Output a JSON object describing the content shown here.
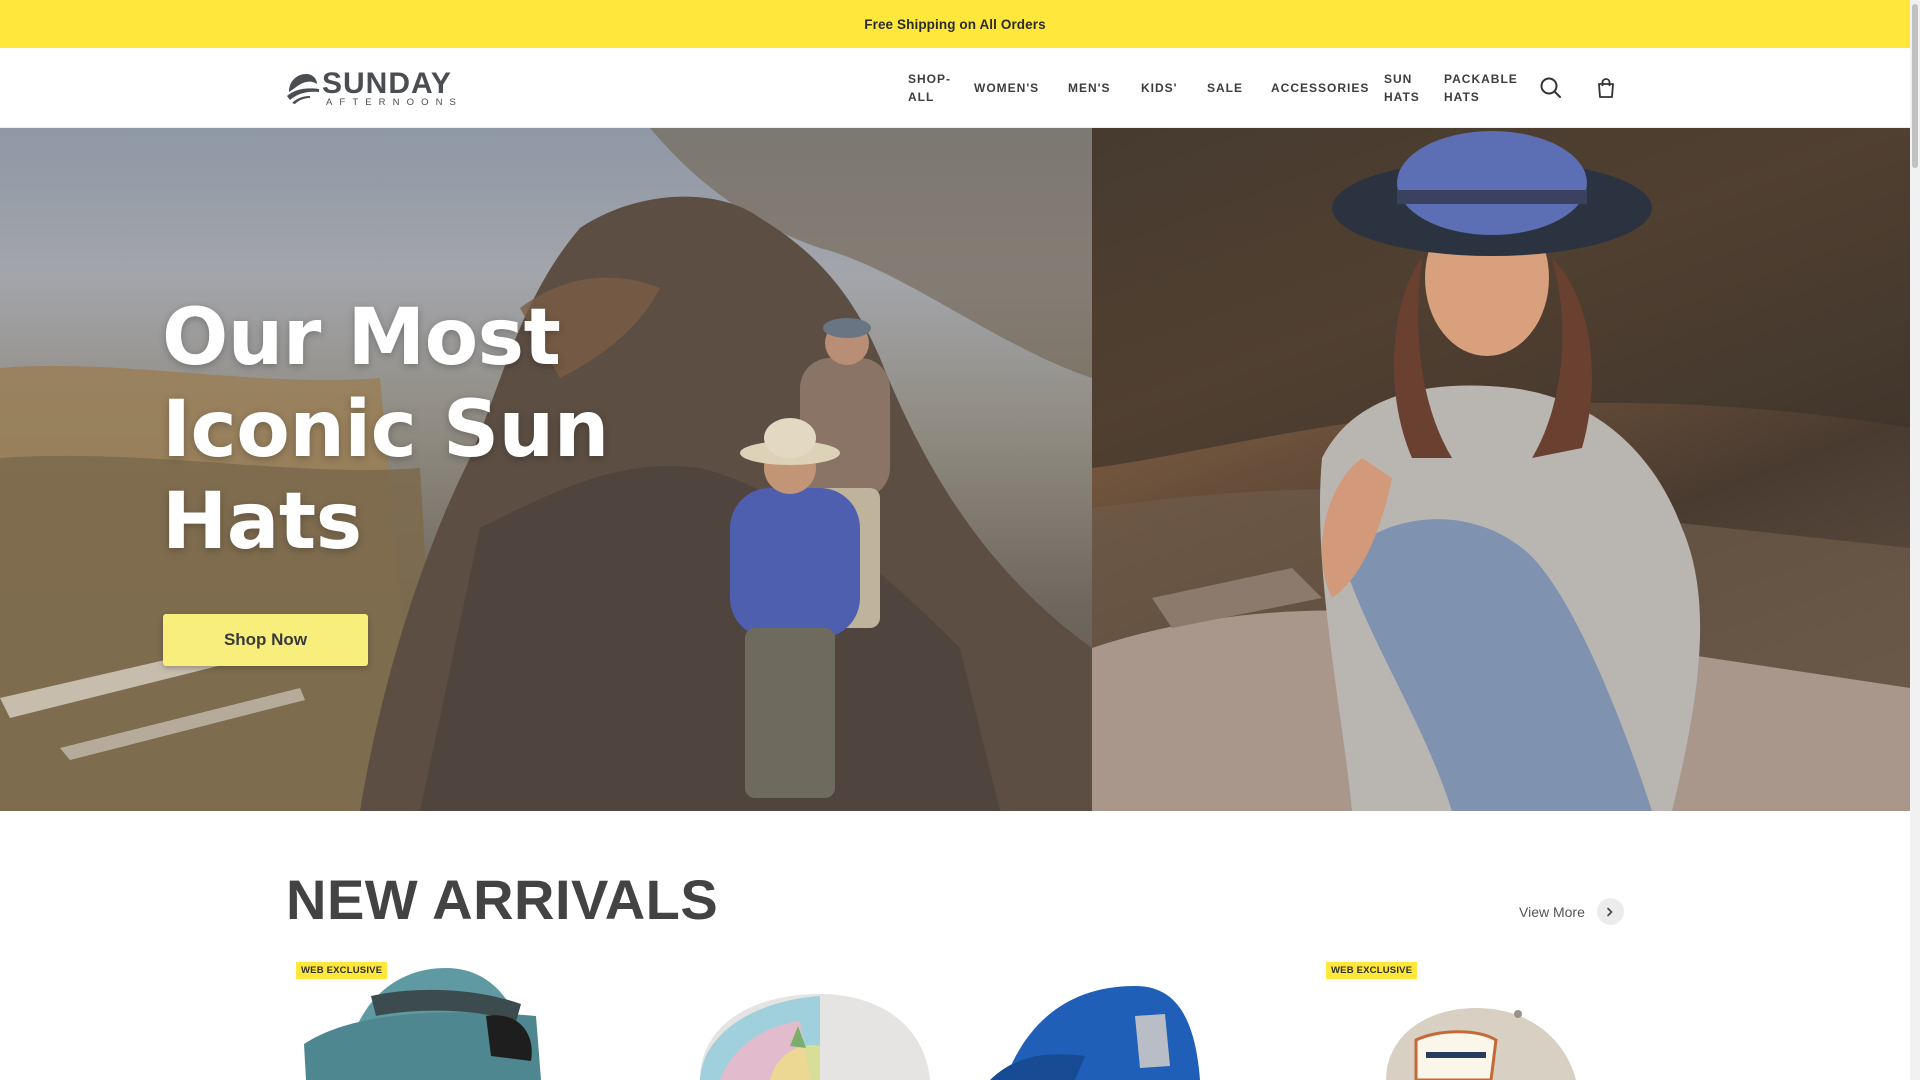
{
  "announcement": {
    "text": "Free Shipping on All Orders"
  },
  "brand": {
    "name": "SUNDAY",
    "tagline": "AFTERNOONS"
  },
  "nav": {
    "items": [
      {
        "label": "SHOP-",
        "label2": "ALL"
      },
      {
        "label": "WOMEN'S"
      },
      {
        "label": "MEN'S"
      },
      {
        "label": "KIDS'"
      },
      {
        "label": "SALE"
      },
      {
        "label": "ACCESSORIES"
      },
      {
        "label": "SUN",
        "label2": "HATS"
      },
      {
        "label": "PACKABLE",
        "label2": "HATS"
      }
    ],
    "icons": {
      "search": "search-icon",
      "cart": "shopping-bag-icon"
    }
  },
  "hero": {
    "title_line1": "Our Most",
    "title_line2": "Iconic Sun",
    "title_line3": "Hats",
    "cta_label": "Shop Now"
  },
  "new_arrivals": {
    "title": "NEW ARRIVALS",
    "view_more": "View More",
    "products": [
      {
        "badge": "WEB EXCLUSIVE"
      },
      {
        "badge": ""
      },
      {
        "badge": ""
      },
      {
        "badge": "WEB EXCLUSIVE"
      }
    ]
  },
  "colors": {
    "announcement_bg": "#ffe83b",
    "cta_bg": "#f8ee7c",
    "badge_bg": "#ffe83b",
    "text_dark": "#434343"
  }
}
